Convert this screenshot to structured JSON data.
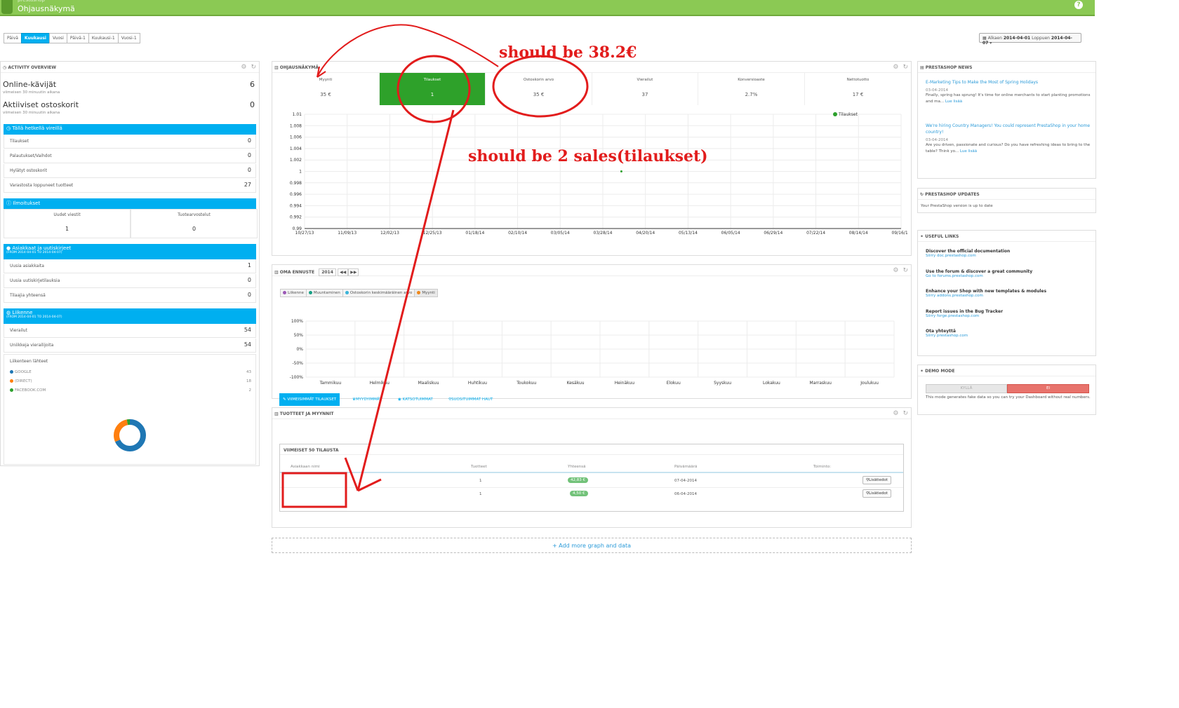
{
  "header": {
    "subtitle": "prestashop",
    "title": "Ohjausnäkymä",
    "help_label": "Ohje",
    "help_icon": "?"
  },
  "periods": [
    "Päivä",
    "Kuukausi",
    "Vuosi",
    "Päivä-1",
    "Kuukausi-1",
    "Vuosi-1"
  ],
  "active_period": "Kuukausi",
  "date_range": {
    "from_label": "Alkaen",
    "from": "2014-04-01",
    "to_label": "Loppuen",
    "to": "2014-04-07"
  },
  "activity": {
    "title": "ACTIVITY OVERVIEW",
    "online_label": "Online-kävijät",
    "online_value": "6",
    "online_sub": "viimeisen 30 minuutin aikana",
    "carts_label": "Aktiiviset ostoskorit",
    "carts_value": "0",
    "carts_sub": "viimeisen 30 minuutin aikana",
    "pending_title": "Tällä hetkellä vireillä",
    "pending": [
      {
        "label": "Tilaukset",
        "value": "0"
      },
      {
        "label": "Palautukset/Vaihdot",
        "value": "0"
      },
      {
        "label": "Hylätyt ostoskorit",
        "value": "0"
      },
      {
        "label": "Varastosta loppuneet tuotteet",
        "value": "27"
      }
    ],
    "notif_title": "Ilmoitukset",
    "notif_new_label": "Uudet viestit",
    "notif_new_value": "1",
    "notif_reviews_label": "Tuotearvostelut",
    "notif_reviews_value": "0",
    "customers_title": "Asiakkaat ja uutiskirjeet",
    "customers_range": "(FROM 2014-04-01 TO 2014-04-07)",
    "customers": [
      {
        "label": "Uusia asiakkaita",
        "value": "1"
      },
      {
        "label": "Uusia uutiskirjetilauksia",
        "value": "0"
      },
      {
        "label": "Tilaajia yhteensä",
        "value": "0"
      }
    ],
    "traffic_title": "Liikenne",
    "traffic_range": "(FROM 2014-04-01 TO 2014-04-07)",
    "traffic": [
      {
        "label": "Vierailut",
        "value": "54"
      },
      {
        "label": "Uniikkeja vierailijoita",
        "value": "54"
      }
    ],
    "sources_title": "Liikenteen lähteet",
    "sources": [
      {
        "label": "GOOGLE",
        "value": "43",
        "color": "#1f77b4"
      },
      {
        "label": "(DIRECT)",
        "value": "18",
        "color": "#ff7f0e"
      },
      {
        "label": "FACEBOOK.COM",
        "value": "2",
        "color": "#2ca02c"
      }
    ]
  },
  "dashboard": {
    "title": "OHJAUSNÄKYMÄ",
    "kpis": [
      {
        "label": "Myynti",
        "value": "35 €"
      },
      {
        "label": "Tilaukset",
        "value": "1"
      },
      {
        "label": "Ostoskorin arvo",
        "value": "35 €"
      },
      {
        "label": "Vierailut",
        "value": "37"
      },
      {
        "label": "Konversioaste",
        "value": "2.7%"
      },
      {
        "label": "Nettotuotto",
        "value": "17 €"
      }
    ]
  },
  "chart_data": [
    {
      "type": "scatter",
      "title": "",
      "legend": "top-right",
      "series": [
        {
          "name": "Tilaukset",
          "x": [
            "04/07/14"
          ],
          "values": [
            1
          ]
        }
      ],
      "x_ticks": [
        "10/27/13",
        "11/09/13",
        "12/02/13",
        "12/25/13",
        "01/18/14",
        "02/10/14",
        "03/05/14",
        "03/28/14",
        "04/20/14",
        "05/13/14",
        "06/05/14",
        "06/29/14",
        "07/22/14",
        "08/14/14",
        "09/16/14"
      ],
      "y_ticks": [
        "1.01",
        "1.008",
        "1.006",
        "1.004",
        "1.002",
        "1",
        "0.998",
        "0.996",
        "0.994",
        "0.992",
        "0.99"
      ],
      "ylim": [
        0.99,
        1.01
      ],
      "grid": true
    },
    {
      "type": "line",
      "title": "",
      "legend": "top-left",
      "series_names": [
        "Liikenne",
        "Muuntaminen",
        "Ostoskorin keskimääräinen arvo",
        "Myynti"
      ],
      "x_ticks": [
        "Tammikuu",
        "Helmikuu",
        "Maaliskuu",
        "Huhtikuu",
        "Toukokuu",
        "Kesäkuu",
        "Heinäkuu",
        "Elokuu",
        "Syyskuu",
        "Lokakuu",
        "Marraskuu",
        "Joulukuu"
      ],
      "y_ticks": [
        "100%",
        "50%",
        "0%",
        "-50%",
        "-100%"
      ],
      "ylim": [
        -100,
        100
      ],
      "grid": true
    },
    {
      "type": "pie",
      "title": "",
      "categories": [
        "GOOGLE",
        "(DIRECT)",
        "FACEBOOK.COM"
      ],
      "values": [
        43,
        18,
        2
      ]
    }
  ],
  "forecast": {
    "title": "OMA ENNUSTE",
    "year": "2014",
    "legend": [
      {
        "label": "Liikenne",
        "color": "#9b59b6"
      },
      {
        "label": "Muuntaminen",
        "color": "#16a085"
      },
      {
        "label": "Ostoskorin keskimääräinen arvo",
        "color": "#3ab4d9"
      },
      {
        "label": "Myynti",
        "color": "#f0881a"
      }
    ]
  },
  "products": {
    "title": "TUOTTEET JA MYYNNIT",
    "tabs": [
      "VIIMEISIMMÄT TILAUKSET",
      "MYYDYIMMÄT",
      "KATSOTUIMMAT",
      "SUOSITUIMMAT HAUT"
    ],
    "table_title": "VIIMEISET 50 TILAUSTA",
    "columns": [
      "Asiakkaan nimi",
      "Tuotteet",
      "Yhteensä",
      "Päivämäärä",
      "Toiminto:"
    ],
    "rows": [
      {
        "products": "1",
        "total": "42,83 €",
        "date": "07-04-2014",
        "action": "Lisätiedot"
      },
      {
        "products": "1",
        "total": "4,50 €",
        "date": "06-04-2014",
        "action": "Lisätiedot"
      }
    ],
    "add_more": "+ Add more graph and data"
  },
  "news": {
    "title": "PRESTASHOP NEWS",
    "items": [
      {
        "title": "E-Marketing Tips to Make the Most of Spring Holidays",
        "date": "03-04-2014",
        "text": "Finally, spring has sprung! It's time for online merchants to start planting promotions and ma...",
        "more": "Lue lisää"
      },
      {
        "title": "We're hiring Country Managers! You could represent PrestaShop in your home country!",
        "date": "03-04-2014",
        "text": "Are you driven, passionate and curious? Do you have refreshing ideas to bring to the table? Think yo...",
        "more": "Lue lisää"
      }
    ]
  },
  "updates": {
    "title": "PRESTASHOP UPDATES",
    "text": "Your PrestaShop version is up to date"
  },
  "links": {
    "title": "USEFUL LINKS",
    "items": [
      {
        "title": "Discover the official documentation",
        "url": "Siirry doc.prestashop.com"
      },
      {
        "title": "Use the forum & discover a great community",
        "url": "Go to forums.prestashop.com"
      },
      {
        "title": "Enhance your Shop with new templates & modules",
        "url": "Siirry addons.prestashop.com"
      },
      {
        "title": "Report issues in the Bug Tracker",
        "url": "Siirry forge.prestashop.com"
      },
      {
        "title": "Ota yhteyttä",
        "url": "Siirry prestashop.com"
      }
    ]
  },
  "demo": {
    "title": "DEMO MODE",
    "yes": "KYLLÄ",
    "no": "EI",
    "text": "This mode generates fake data so you can try your Dashboard without real numbers."
  },
  "annotations": {
    "note1": "should be 38.2€",
    "note2": "should be 2 sales(tilaukset)",
    "color": "#e21c1c"
  },
  "colors": {
    "header_green": "#8bc954",
    "accent_blue": "#00aff0",
    "kpi_active": "#2ea12a",
    "demo_no": "#e8736c"
  }
}
